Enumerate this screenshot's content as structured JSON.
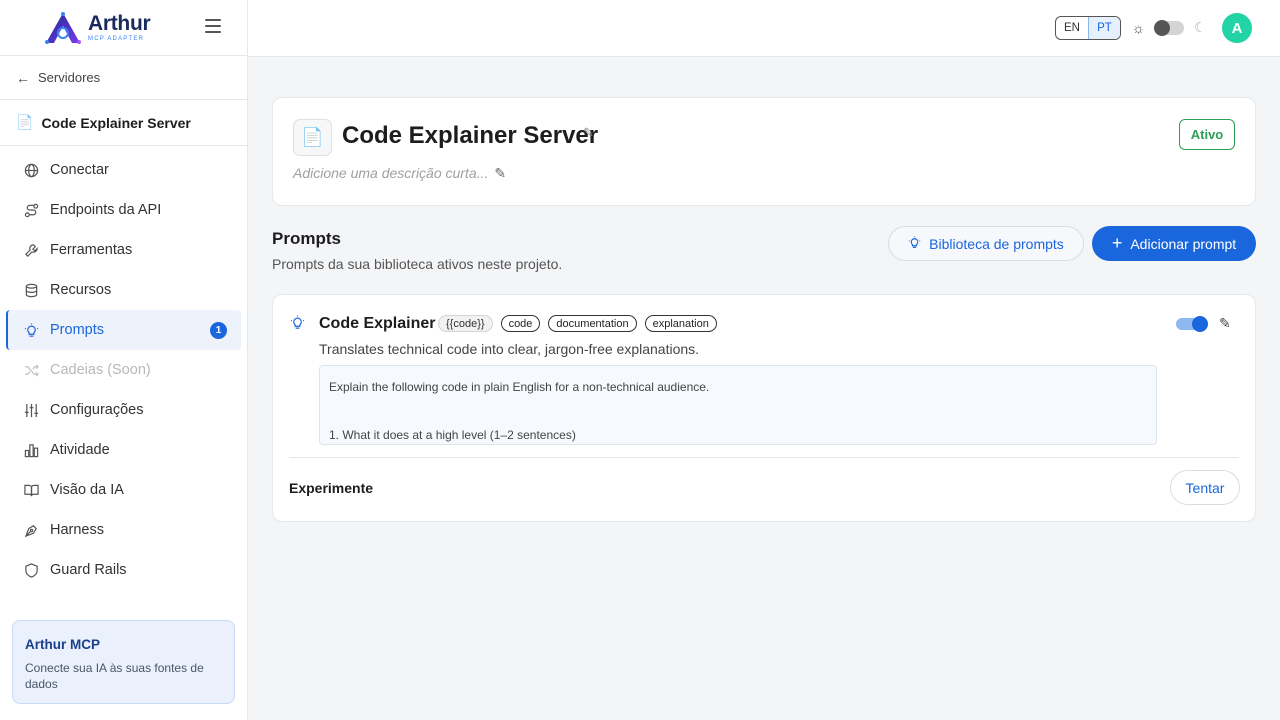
{
  "brand": {
    "name": "Arthur",
    "subtitle": "MCP ADAPTER",
    "accent": "#1a66dd"
  },
  "sidebar": {
    "back_label": "Servidores",
    "server_name": "Code Explainer Server",
    "items": [
      {
        "label": "Conectar",
        "icon": "globe-icon"
      },
      {
        "label": "Endpoints da API",
        "icon": "route-icon"
      },
      {
        "label": "Ferramentas",
        "icon": "wrench-icon"
      },
      {
        "label": "Recursos",
        "icon": "database-icon"
      },
      {
        "label": "Prompts",
        "icon": "lightbulb-icon",
        "active": true,
        "badge": "1"
      },
      {
        "label": "Cadeias (Soon)",
        "icon": "shuffle-icon",
        "disabled": true
      },
      {
        "label": "Configurações",
        "icon": "sliders-icon"
      },
      {
        "label": "Atividade",
        "icon": "bar-chart-icon"
      },
      {
        "label": "Visão da IA",
        "icon": "book-icon"
      },
      {
        "label": "Harness",
        "icon": "pen-tool-icon"
      },
      {
        "label": "Guard Rails",
        "icon": "shield-icon"
      }
    ],
    "promo": {
      "title": "Arthur MCP",
      "text": "Conecte sua IA às suas fontes de dados"
    }
  },
  "topbar": {
    "languages": [
      "EN",
      "PT"
    ],
    "selected_language": "PT",
    "dark_mode": false,
    "avatar_letter": "A",
    "avatar_color": "#22d3a5"
  },
  "server": {
    "title": "Code Explainer Server",
    "description_placeholder": "Adicione uma descrição curta...",
    "status": "Ativo",
    "status_color": "#2f9e56"
  },
  "prompts_section": {
    "title": "Prompts",
    "subtitle": "Prompts da sua biblioteca ativos neste projeto.",
    "library_button": "Biblioteca de prompts",
    "add_button": "Adicionar prompt"
  },
  "prompt": {
    "name": "Code Explainer",
    "variable_tag": "{{code}}",
    "tags": [
      "code",
      "documentation",
      "explanation"
    ],
    "description": "Translates technical code into clear, jargon-free explanations.",
    "text_line1": "Explain the following code in plain English for a non-technical audience.",
    "text_line2": "1. What it does at a high level (1–2 sentences)",
    "enabled": true,
    "try_label": "Experimente",
    "try_button": "Tentar"
  }
}
